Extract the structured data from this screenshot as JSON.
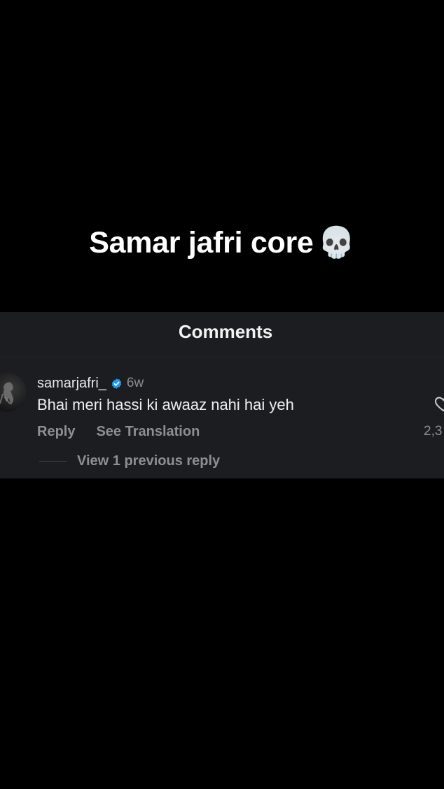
{
  "caption": {
    "text": "Samar jafri core",
    "emoji": "💀"
  },
  "comments_panel": {
    "title": "Comments"
  },
  "comment": {
    "username": "samarjafri_",
    "verified_icon": "verified-badge-icon",
    "time": "6w",
    "text": "Bhai meri hassi ki awaaz nahi hai yeh",
    "reply_label": "Reply",
    "translate_label": "See Translation",
    "like_icon": "heart-outline-icon",
    "like_count": "2,3",
    "view_replies_label": "View 1 previous reply"
  },
  "colors": {
    "background": "#000000",
    "panel": "#1b1d20",
    "verified": "#1d9bf0",
    "muted_text": "#8d8f93"
  }
}
